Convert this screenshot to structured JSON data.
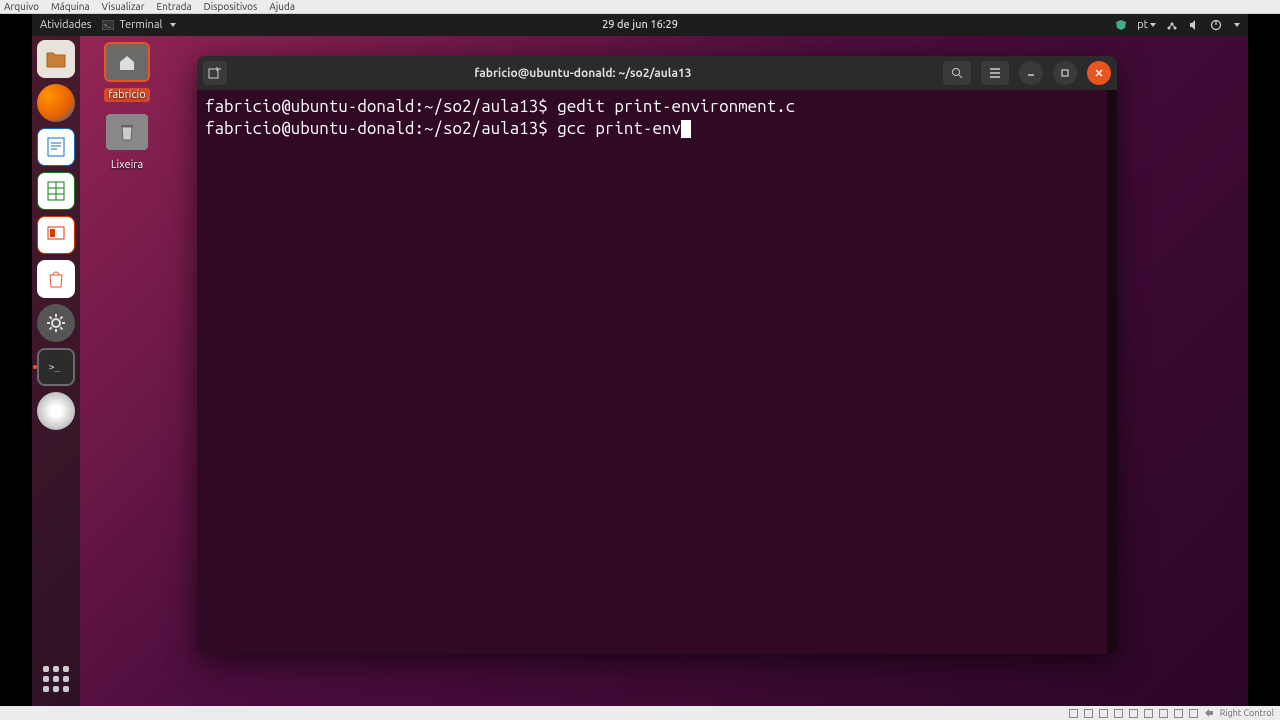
{
  "vbox_menu": {
    "items": [
      "Arquivo",
      "Máquina",
      "Visualizar",
      "Entrada",
      "Dispositivos",
      "Ajuda"
    ]
  },
  "topbar": {
    "activities": "Atividades",
    "app_name": "Terminal",
    "datetime": "29 de jun  16:29",
    "lang": "pt"
  },
  "desktop": {
    "home_label": "fabricio",
    "trash_label": "Lixeira"
  },
  "terminal": {
    "title": "fabricio@ubuntu-donald: ~/so2/aula13",
    "lines": [
      {
        "prompt": "fabricio@ubuntu-donald:~/so2/aula13$ ",
        "cmd": "gedit print-environment.c"
      },
      {
        "prompt": "fabricio@ubuntu-donald:~/so2/aula13$ ",
        "cmd": "gcc print-env"
      }
    ]
  },
  "vbox_status": {
    "hostkey": "Right Control"
  }
}
